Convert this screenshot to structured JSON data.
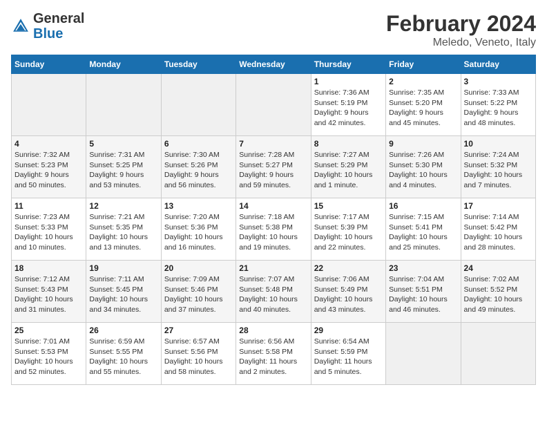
{
  "header": {
    "logo_general": "General",
    "logo_blue": "Blue",
    "month_year": "February 2024",
    "location": "Meledo, Veneto, Italy"
  },
  "days_of_week": [
    "Sunday",
    "Monday",
    "Tuesday",
    "Wednesday",
    "Thursday",
    "Friday",
    "Saturday"
  ],
  "weeks": [
    [
      {
        "day": "",
        "info": ""
      },
      {
        "day": "",
        "info": ""
      },
      {
        "day": "",
        "info": ""
      },
      {
        "day": "",
        "info": ""
      },
      {
        "day": "1",
        "info": "Sunrise: 7:36 AM\nSunset: 5:19 PM\nDaylight: 9 hours\nand 42 minutes."
      },
      {
        "day": "2",
        "info": "Sunrise: 7:35 AM\nSunset: 5:20 PM\nDaylight: 9 hours\nand 45 minutes."
      },
      {
        "day": "3",
        "info": "Sunrise: 7:33 AM\nSunset: 5:22 PM\nDaylight: 9 hours\nand 48 minutes."
      }
    ],
    [
      {
        "day": "4",
        "info": "Sunrise: 7:32 AM\nSunset: 5:23 PM\nDaylight: 9 hours\nand 50 minutes."
      },
      {
        "day": "5",
        "info": "Sunrise: 7:31 AM\nSunset: 5:25 PM\nDaylight: 9 hours\nand 53 minutes."
      },
      {
        "day": "6",
        "info": "Sunrise: 7:30 AM\nSunset: 5:26 PM\nDaylight: 9 hours\nand 56 minutes."
      },
      {
        "day": "7",
        "info": "Sunrise: 7:28 AM\nSunset: 5:27 PM\nDaylight: 9 hours\nand 59 minutes."
      },
      {
        "day": "8",
        "info": "Sunrise: 7:27 AM\nSunset: 5:29 PM\nDaylight: 10 hours\nand 1 minute."
      },
      {
        "day": "9",
        "info": "Sunrise: 7:26 AM\nSunset: 5:30 PM\nDaylight: 10 hours\nand 4 minutes."
      },
      {
        "day": "10",
        "info": "Sunrise: 7:24 AM\nSunset: 5:32 PM\nDaylight: 10 hours\nand 7 minutes."
      }
    ],
    [
      {
        "day": "11",
        "info": "Sunrise: 7:23 AM\nSunset: 5:33 PM\nDaylight: 10 hours\nand 10 minutes."
      },
      {
        "day": "12",
        "info": "Sunrise: 7:21 AM\nSunset: 5:35 PM\nDaylight: 10 hours\nand 13 minutes."
      },
      {
        "day": "13",
        "info": "Sunrise: 7:20 AM\nSunset: 5:36 PM\nDaylight: 10 hours\nand 16 minutes."
      },
      {
        "day": "14",
        "info": "Sunrise: 7:18 AM\nSunset: 5:38 PM\nDaylight: 10 hours\nand 19 minutes."
      },
      {
        "day": "15",
        "info": "Sunrise: 7:17 AM\nSunset: 5:39 PM\nDaylight: 10 hours\nand 22 minutes."
      },
      {
        "day": "16",
        "info": "Sunrise: 7:15 AM\nSunset: 5:41 PM\nDaylight: 10 hours\nand 25 minutes."
      },
      {
        "day": "17",
        "info": "Sunrise: 7:14 AM\nSunset: 5:42 PM\nDaylight: 10 hours\nand 28 minutes."
      }
    ],
    [
      {
        "day": "18",
        "info": "Sunrise: 7:12 AM\nSunset: 5:43 PM\nDaylight: 10 hours\nand 31 minutes."
      },
      {
        "day": "19",
        "info": "Sunrise: 7:11 AM\nSunset: 5:45 PM\nDaylight: 10 hours\nand 34 minutes."
      },
      {
        "day": "20",
        "info": "Sunrise: 7:09 AM\nSunset: 5:46 PM\nDaylight: 10 hours\nand 37 minutes."
      },
      {
        "day": "21",
        "info": "Sunrise: 7:07 AM\nSunset: 5:48 PM\nDaylight: 10 hours\nand 40 minutes."
      },
      {
        "day": "22",
        "info": "Sunrise: 7:06 AM\nSunset: 5:49 PM\nDaylight: 10 hours\nand 43 minutes."
      },
      {
        "day": "23",
        "info": "Sunrise: 7:04 AM\nSunset: 5:51 PM\nDaylight: 10 hours\nand 46 minutes."
      },
      {
        "day": "24",
        "info": "Sunrise: 7:02 AM\nSunset: 5:52 PM\nDaylight: 10 hours\nand 49 minutes."
      }
    ],
    [
      {
        "day": "25",
        "info": "Sunrise: 7:01 AM\nSunset: 5:53 PM\nDaylight: 10 hours\nand 52 minutes."
      },
      {
        "day": "26",
        "info": "Sunrise: 6:59 AM\nSunset: 5:55 PM\nDaylight: 10 hours\nand 55 minutes."
      },
      {
        "day": "27",
        "info": "Sunrise: 6:57 AM\nSunset: 5:56 PM\nDaylight: 10 hours\nand 58 minutes."
      },
      {
        "day": "28",
        "info": "Sunrise: 6:56 AM\nSunset: 5:58 PM\nDaylight: 11 hours\nand 2 minutes."
      },
      {
        "day": "29",
        "info": "Sunrise: 6:54 AM\nSunset: 5:59 PM\nDaylight: 11 hours\nand 5 minutes."
      },
      {
        "day": "",
        "info": ""
      },
      {
        "day": "",
        "info": ""
      }
    ]
  ]
}
